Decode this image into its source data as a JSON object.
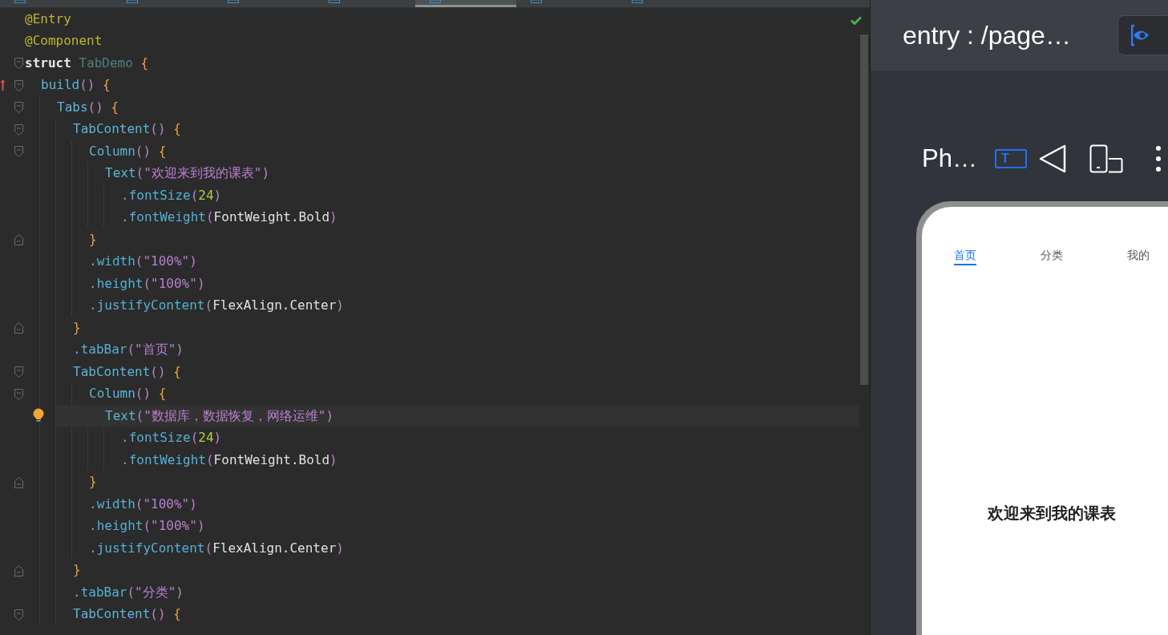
{
  "editor": {
    "tabs": [
      {
        "selected": false
      },
      {
        "selected": false
      },
      {
        "selected": false
      },
      {
        "selected": false
      },
      {
        "selected": true
      },
      {
        "selected": false
      },
      {
        "selected": false
      }
    ],
    "lines": [
      {
        "fold_start": false,
        "fold_end": false,
        "override": false,
        "bulb": false,
        "current": false,
        "tokens": [
          {
            "kind": "annotation",
            "text": "@Entry"
          }
        ]
      },
      {
        "fold_start": false,
        "fold_end": false,
        "override": false,
        "bulb": false,
        "current": false,
        "tokens": [
          {
            "kind": "annotation",
            "text": "@Component"
          }
        ]
      },
      {
        "fold_start": true,
        "fold_end": false,
        "override": false,
        "bulb": false,
        "current": false,
        "tokens": [
          {
            "kind": "keyword",
            "text": "struct"
          },
          {
            "kind": "classname",
            "text": " TabDemo"
          },
          {
            "kind": "brace",
            "text": " {"
          }
        ],
        "children": [
          {
            "fold_start": true,
            "fold_end": false,
            "override": true,
            "bulb": false,
            "current": false,
            "tokens": [
              {
                "kind": "func",
                "text": "build"
              },
              {
                "kind": "paren",
                "text": "()"
              },
              {
                "kind": "brace",
                "text": " {"
              }
            ],
            "children": [
              {
                "fold_start": true,
                "fold_end": false,
                "override": false,
                "bulb": false,
                "current": false,
                "tokens": [
                  {
                    "kind": "func",
                    "text": "Tabs"
                  },
                  {
                    "kind": "paren",
                    "text": "()"
                  },
                  {
                    "kind": "brace",
                    "text": " {"
                  }
                ],
                "children": [
                  {
                    "fold_start": true,
                    "fold_end": false,
                    "override": false,
                    "bulb": false,
                    "current": false,
                    "tokens": [
                      {
                        "kind": "func",
                        "text": "TabContent"
                      },
                      {
                        "kind": "paren",
                        "text": "()"
                      },
                      {
                        "kind": "brace",
                        "text": " {"
                      }
                    ],
                    "children": [
                      {
                        "fold_start": true,
                        "fold_end": false,
                        "override": false,
                        "bulb": false,
                        "current": false,
                        "tokens": [
                          {
                            "kind": "func",
                            "text": "Column"
                          },
                          {
                            "kind": "paren",
                            "text": "()"
                          },
                          {
                            "kind": "brace",
                            "text": " {"
                          }
                        ],
                        "children": [
                          {
                            "fold_start": false,
                            "fold_end": false,
                            "override": false,
                            "bulb": false,
                            "current": false,
                            "tokens": [
                              {
                                "kind": "func",
                                "text": "Text"
                              },
                              {
                                "kind": "paren",
                                "text": "("
                              },
                              {
                                "kind": "string",
                                "text": "\"欢迎来到我的课表\""
                              },
                              {
                                "kind": "paren",
                                "text": ")"
                              }
                            ],
                            "children": [
                              {
                                "fold_start": false,
                                "fold_end": false,
                                "override": false,
                                "bulb": false,
                                "current": false,
                                "tokens": [
                                  {
                                    "kind": "method",
                                    "text": ".fontSize"
                                  },
                                  {
                                    "kind": "paren",
                                    "text": "("
                                  },
                                  {
                                    "kind": "number",
                                    "text": "24"
                                  },
                                  {
                                    "kind": "paren",
                                    "text": ")"
                                  }
                                ]
                              },
                              {
                                "fold_start": false,
                                "fold_end": false,
                                "override": false,
                                "bulb": false,
                                "current": false,
                                "tokens": [
                                  {
                                    "kind": "method",
                                    "text": ".fontWeight"
                                  },
                                  {
                                    "kind": "paren",
                                    "text": "("
                                  },
                                  {
                                    "kind": "plain",
                                    "text": "FontWeight.Bold"
                                  },
                                  {
                                    "kind": "paren",
                                    "text": ")"
                                  }
                                ]
                              }
                            ]
                          }
                        ]
                      },
                      {
                        "fold_start": false,
                        "fold_end": true,
                        "override": false,
                        "bulb": false,
                        "current": false,
                        "tokens": [
                          {
                            "kind": "brace",
                            "text": "}"
                          }
                        ]
                      },
                      {
                        "fold_start": false,
                        "fold_end": false,
                        "override": false,
                        "bulb": false,
                        "current": false,
                        "tokens": [
                          {
                            "kind": "method",
                            "text": ".width"
                          },
                          {
                            "kind": "paren",
                            "text": "("
                          },
                          {
                            "kind": "string",
                            "text": "\"100%\""
                          },
                          {
                            "kind": "paren",
                            "text": ")"
                          }
                        ]
                      },
                      {
                        "fold_start": false,
                        "fold_end": false,
                        "override": false,
                        "bulb": false,
                        "current": false,
                        "tokens": [
                          {
                            "kind": "method",
                            "text": ".height"
                          },
                          {
                            "kind": "paren",
                            "text": "("
                          },
                          {
                            "kind": "string",
                            "text": "\"100%\""
                          },
                          {
                            "kind": "paren",
                            "text": ")"
                          }
                        ]
                      },
                      {
                        "fold_start": false,
                        "fold_end": false,
                        "override": false,
                        "bulb": false,
                        "current": false,
                        "tokens": [
                          {
                            "kind": "method",
                            "text": ".justifyContent"
                          },
                          {
                            "kind": "paren",
                            "text": "("
                          },
                          {
                            "kind": "plain",
                            "text": "FlexAlign.Center"
                          },
                          {
                            "kind": "paren",
                            "text": ")"
                          }
                        ]
                      }
                    ]
                  },
                  {
                    "fold_start": false,
                    "fold_end": true,
                    "override": false,
                    "bulb": false,
                    "current": false,
                    "tokens": [
                      {
                        "kind": "brace",
                        "text": "}"
                      }
                    ]
                  },
                  {
                    "fold_start": false,
                    "fold_end": false,
                    "override": false,
                    "bulb": false,
                    "current": false,
                    "tokens": [
                      {
                        "kind": "method",
                        "text": ".tabBar"
                      },
                      {
                        "kind": "paren",
                        "text": "("
                      },
                      {
                        "kind": "string",
                        "text": "\"首页\""
                      },
                      {
                        "kind": "paren",
                        "text": ")"
                      }
                    ]
                  },
                  {
                    "fold_start": true,
                    "fold_end": false,
                    "override": false,
                    "bulb": false,
                    "current": false,
                    "tokens": [
                      {
                        "kind": "func",
                        "text": "TabContent"
                      },
                      {
                        "kind": "paren",
                        "text": "()"
                      },
                      {
                        "kind": "brace",
                        "text": " {"
                      }
                    ],
                    "children": [
                      {
                        "fold_start": true,
                        "fold_end": false,
                        "override": false,
                        "bulb": false,
                        "current": false,
                        "tokens": [
                          {
                            "kind": "func",
                            "text": "Column"
                          },
                          {
                            "kind": "paren",
                            "text": "()"
                          },
                          {
                            "kind": "brace",
                            "text": " {"
                          }
                        ],
                        "children": [
                          {
                            "fold_start": false,
                            "fold_end": false,
                            "override": false,
                            "bulb": true,
                            "current": true,
                            "tokens": [
                              {
                                "kind": "func",
                                "text": "Text"
                              },
                              {
                                "kind": "paren",
                                "text": "("
                              },
                              {
                                "kind": "string",
                                "text": "\"数据库，数据恢复，网络运维\""
                              },
                              {
                                "kind": "paren",
                                "text": ")"
                              }
                            ],
                            "children": [
                              {
                                "fold_start": false,
                                "fold_end": false,
                                "override": false,
                                "bulb": false,
                                "current": false,
                                "tokens": [
                                  {
                                    "kind": "method",
                                    "text": ".fontSize"
                                  },
                                  {
                                    "kind": "paren",
                                    "text": "("
                                  },
                                  {
                                    "kind": "number",
                                    "text": "24"
                                  },
                                  {
                                    "kind": "paren",
                                    "text": ")"
                                  }
                                ]
                              },
                              {
                                "fold_start": false,
                                "fold_end": false,
                                "override": false,
                                "bulb": false,
                                "current": false,
                                "tokens": [
                                  {
                                    "kind": "method",
                                    "text": ".fontWeight"
                                  },
                                  {
                                    "kind": "paren",
                                    "text": "("
                                  },
                                  {
                                    "kind": "plain",
                                    "text": "FontWeight.Bold"
                                  },
                                  {
                                    "kind": "paren",
                                    "text": ")"
                                  }
                                ]
                              }
                            ]
                          }
                        ]
                      },
                      {
                        "fold_start": false,
                        "fold_end": true,
                        "override": false,
                        "bulb": false,
                        "current": false,
                        "tokens": [
                          {
                            "kind": "brace",
                            "text": "}"
                          }
                        ]
                      },
                      {
                        "fold_start": false,
                        "fold_end": false,
                        "override": false,
                        "bulb": false,
                        "current": false,
                        "tokens": [
                          {
                            "kind": "method",
                            "text": ".width"
                          },
                          {
                            "kind": "paren",
                            "text": "("
                          },
                          {
                            "kind": "string",
                            "text": "\"100%\""
                          },
                          {
                            "kind": "paren",
                            "text": ")"
                          }
                        ]
                      },
                      {
                        "fold_start": false,
                        "fold_end": false,
                        "override": false,
                        "bulb": false,
                        "current": false,
                        "tokens": [
                          {
                            "kind": "method",
                            "text": ".height"
                          },
                          {
                            "kind": "paren",
                            "text": "("
                          },
                          {
                            "kind": "string",
                            "text": "\"100%\""
                          },
                          {
                            "kind": "paren",
                            "text": ")"
                          }
                        ]
                      },
                      {
                        "fold_start": false,
                        "fold_end": false,
                        "override": false,
                        "bulb": false,
                        "current": false,
                        "tokens": [
                          {
                            "kind": "method",
                            "text": ".justifyContent"
                          },
                          {
                            "kind": "paren",
                            "text": "("
                          },
                          {
                            "kind": "plain",
                            "text": "FlexAlign.Center"
                          },
                          {
                            "kind": "paren",
                            "text": ")"
                          }
                        ]
                      }
                    ]
                  },
                  {
                    "fold_start": false,
                    "fold_end": true,
                    "override": false,
                    "bulb": false,
                    "current": false,
                    "tokens": [
                      {
                        "kind": "brace",
                        "text": "}"
                      }
                    ]
                  },
                  {
                    "fold_start": false,
                    "fold_end": false,
                    "override": false,
                    "bulb": false,
                    "current": false,
                    "tokens": [
                      {
                        "kind": "method",
                        "text": ".tabBar"
                      },
                      {
                        "kind": "paren",
                        "text": "("
                      },
                      {
                        "kind": "string",
                        "text": "\"分类\""
                      },
                      {
                        "kind": "paren",
                        "text": ")"
                      }
                    ]
                  },
                  {
                    "fold_start": true,
                    "fold_end": false,
                    "override": false,
                    "bulb": false,
                    "current": false,
                    "tokens": [
                      {
                        "kind": "func",
                        "text": "TabContent"
                      },
                      {
                        "kind": "paren",
                        "text": "()"
                      },
                      {
                        "kind": "brace",
                        "text": " {"
                      }
                    ]
                  }
                ]
              }
            ]
          }
        ]
      }
    ]
  },
  "preview": {
    "title": "entry : /page…",
    "device": "Ph…",
    "text_tool": "T",
    "phone": {
      "tabs": [
        {
          "label": "首页",
          "selected": true
        },
        {
          "label": "分类",
          "selected": false
        },
        {
          "label": "我的",
          "selected": false
        }
      ],
      "content": "欢迎来到我的课表"
    }
  }
}
